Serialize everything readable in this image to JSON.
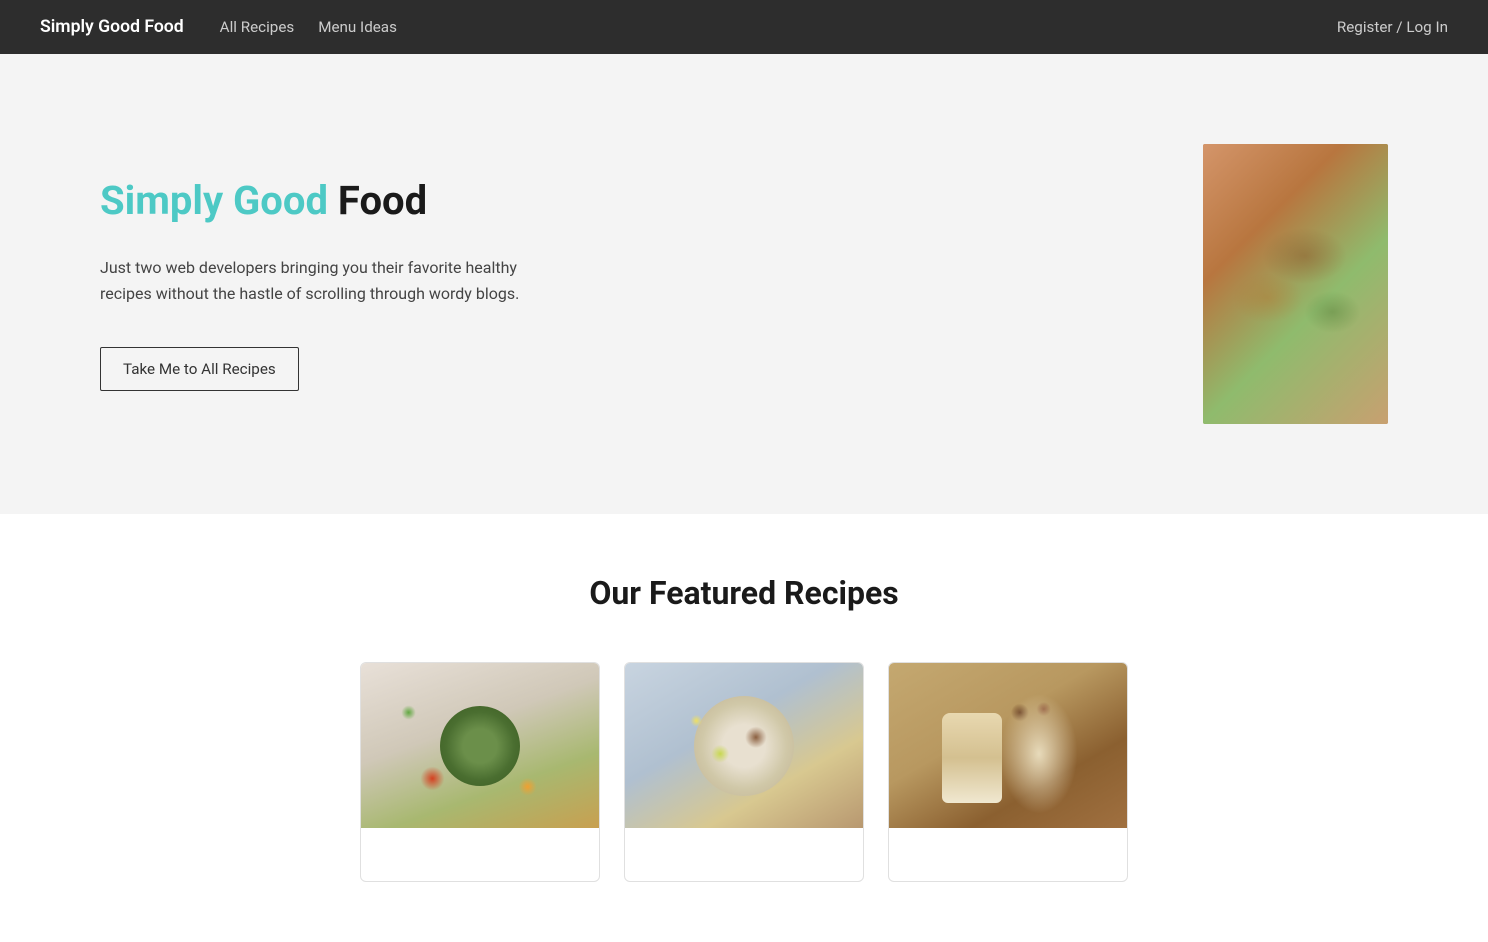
{
  "nav": {
    "brand": "Simply Good Food",
    "links": [
      {
        "label": "All Recipes",
        "name": "all-recipes"
      },
      {
        "label": "Menu Ideas",
        "name": "menu-ideas"
      }
    ],
    "auth": "Register / Log In"
  },
  "hero": {
    "title_colored": "Simply Good",
    "title_dark": " Food",
    "description": "Just two web developers bringing you their favorite healthy recipes without the hastle of scrolling through wordy blogs.",
    "cta_button": "Take Me to All Recipes",
    "image_alt": "Healthy food platter"
  },
  "featured": {
    "section_title": "Our Featured Recipes",
    "cards": [
      {
        "id": 1,
        "alt": "Guacamole in a bowl"
      },
      {
        "id": 2,
        "alt": "Rice and salmon bowl"
      },
      {
        "id": 3,
        "alt": "Layered dessert cups"
      }
    ]
  }
}
